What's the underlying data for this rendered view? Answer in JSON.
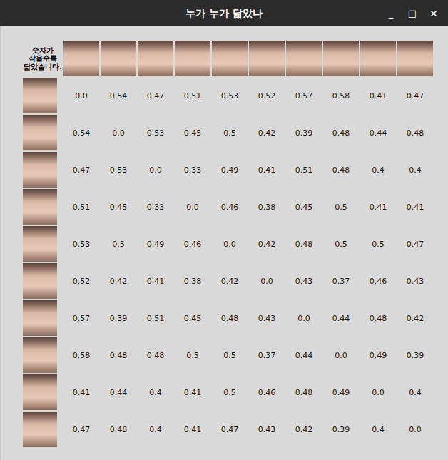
{
  "window": {
    "title": "누가 누가 닮았나",
    "controls": [
      "_",
      "□",
      "×"
    ]
  },
  "table": {
    "corner_label": "숫자가 작을수록 닮았습니다.",
    "rows": [
      [
        "0.0",
        "0.54",
        "0.47",
        "0.51",
        "0.53",
        "0.52",
        "0.57",
        "0.58",
        "0.41",
        "0.47"
      ],
      [
        "0.54",
        "0.0",
        "0.53",
        "0.45",
        "0.5",
        "0.42",
        "0.39",
        "0.48",
        "0.44",
        "0.48"
      ],
      [
        "0.47",
        "0.53",
        "0.0",
        "0.33",
        "0.49",
        "0.41",
        "0.51",
        "0.48",
        "0.4",
        "0.4"
      ],
      [
        "0.51",
        "0.45",
        "0.33",
        "0.0",
        "0.46",
        "0.38",
        "0.45",
        "0.5",
        "0.41",
        "0.41"
      ],
      [
        "0.53",
        "0.5",
        "0.49",
        "0.46",
        "0.0",
        "0.42",
        "0.48",
        "0.5",
        "0.5",
        "0.47"
      ],
      [
        "0.52",
        "0.42",
        "0.41",
        "0.38",
        "0.42",
        "0.0",
        "0.43",
        "0.37",
        "0.46",
        "0.43"
      ],
      [
        "0.57",
        "0.39",
        "0.51",
        "0.45",
        "0.48",
        "0.43",
        "0.0",
        "0.44",
        "0.48",
        "0.42"
      ],
      [
        "0.58",
        "0.48",
        "0.48",
        "0.5",
        "0.5",
        "0.37",
        "0.44",
        "0.0",
        "0.49",
        "0.39"
      ],
      [
        "0.41",
        "0.44",
        "0.4",
        "0.41",
        "0.5",
        "0.46",
        "0.48",
        "0.49",
        "0.0",
        "0.4"
      ],
      [
        "0.47",
        "0.48",
        "0.4",
        "0.41",
        "0.47",
        "0.43",
        "0.42",
        "0.39",
        "0.4",
        "0.0"
      ]
    ]
  }
}
